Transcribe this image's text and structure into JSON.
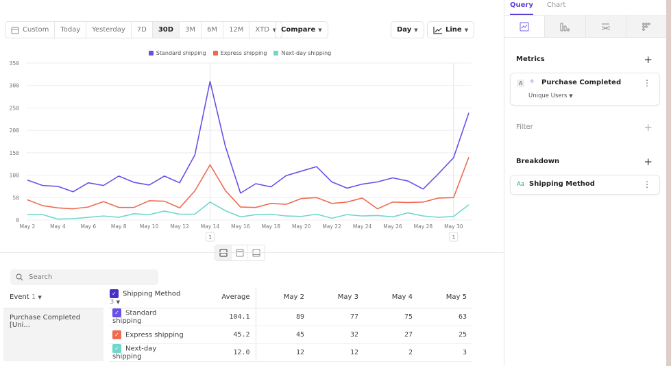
{
  "toolbar": {
    "date_ranges": [
      "Custom",
      "Today",
      "Yesterday",
      "7D",
      "30D",
      "3M",
      "6M",
      "12M",
      "XTD"
    ],
    "active": "30D",
    "compare": "Compare",
    "interval": "Day",
    "chart_type": "Line"
  },
  "chart_data": {
    "type": "line",
    "x": [
      "May 2",
      "May 3",
      "May 4",
      "May 5",
      "May 6",
      "May 7",
      "May 8",
      "May 9",
      "May 10",
      "May 11",
      "May 12",
      "May 13",
      "May 14",
      "May 15",
      "May 16",
      "May 17",
      "May 18",
      "May 19",
      "May 20",
      "May 21",
      "May 22",
      "May 23",
      "May 24",
      "May 25",
      "May 26",
      "May 27",
      "May 28",
      "May 29",
      "May 30",
      "May 31"
    ],
    "x_tick_labels": [
      "May 2",
      "May 4",
      "May 6",
      "May 8",
      "May 10",
      "May 12",
      "May 14",
      "May 16",
      "May 18",
      "May 20",
      "May 22",
      "May 24",
      "May 26",
      "May 28",
      "May 30"
    ],
    "y_ticks": [
      0,
      50,
      100,
      150,
      200,
      250,
      300,
      350
    ],
    "ylim": [
      0,
      350
    ],
    "grid": true,
    "legend": "top",
    "series": [
      {
        "name": "Standard shipping",
        "color": "#6a4ee8",
        "values": [
          89,
          77,
          75,
          63,
          83,
          77,
          98,
          84,
          78,
          98,
          83,
          145,
          309,
          165,
          60,
          81,
          74,
          99,
          109,
          119,
          85,
          71,
          80,
          85,
          94,
          87,
          69,
          103,
          139,
          239
        ]
      },
      {
        "name": "Express shipping",
        "color": "#ef6a50",
        "values": [
          45,
          32,
          27,
          25,
          29,
          41,
          28,
          28,
          43,
          42,
          27,
          65,
          123,
          66,
          29,
          28,
          37,
          35,
          48,
          50,
          37,
          40,
          49,
          25,
          40,
          39,
          40,
          49,
          50,
          140
        ]
      },
      {
        "name": "Next-day shipping",
        "color": "#6fd8cb",
        "values": [
          12,
          12,
          2,
          3,
          6,
          9,
          6,
          14,
          12,
          20,
          13,
          13,
          40,
          21,
          7,
          12,
          13,
          9,
          8,
          13,
          4,
          12,
          9,
          10,
          7,
          16,
          9,
          6,
          8,
          34
        ]
      }
    ],
    "annotations": [
      {
        "x": "May 14",
        "label": "1"
      },
      {
        "x": "May 30",
        "label": "1"
      }
    ]
  },
  "table": {
    "search_placeholder": "Search",
    "event_header": "Event",
    "event_count": "1",
    "breakdown_header": "Shipping Method",
    "breakdown_count": "3",
    "average_header": "Average",
    "date_headers": [
      "May 2",
      "May 3",
      "May 4",
      "May 5"
    ],
    "event_name": "Purchase Completed [Uni...",
    "rows": [
      {
        "name": "Standard shipping",
        "color": "#6a4ee8",
        "average": "104.1",
        "values": [
          "89",
          "77",
          "75",
          "63"
        ]
      },
      {
        "name": "Express shipping",
        "color": "#ef6a50",
        "average": "45.2",
        "values": [
          "45",
          "32",
          "27",
          "25"
        ]
      },
      {
        "name": "Next-day shipping",
        "color": "#6fd8cb",
        "average": "12.0",
        "values": [
          "12",
          "12",
          "2",
          "3"
        ]
      }
    ]
  },
  "sidebar": {
    "tabs": [
      "Query",
      "Chart"
    ],
    "metrics_label": "Metrics",
    "metric_letter": "A",
    "metric_name": "Purchase Completed",
    "metric_measure": "Unique Users",
    "filter_label": "Filter",
    "breakdown_label": "Breakdown",
    "breakdown_type": "Aa",
    "breakdown_name": "Shipping Method"
  }
}
